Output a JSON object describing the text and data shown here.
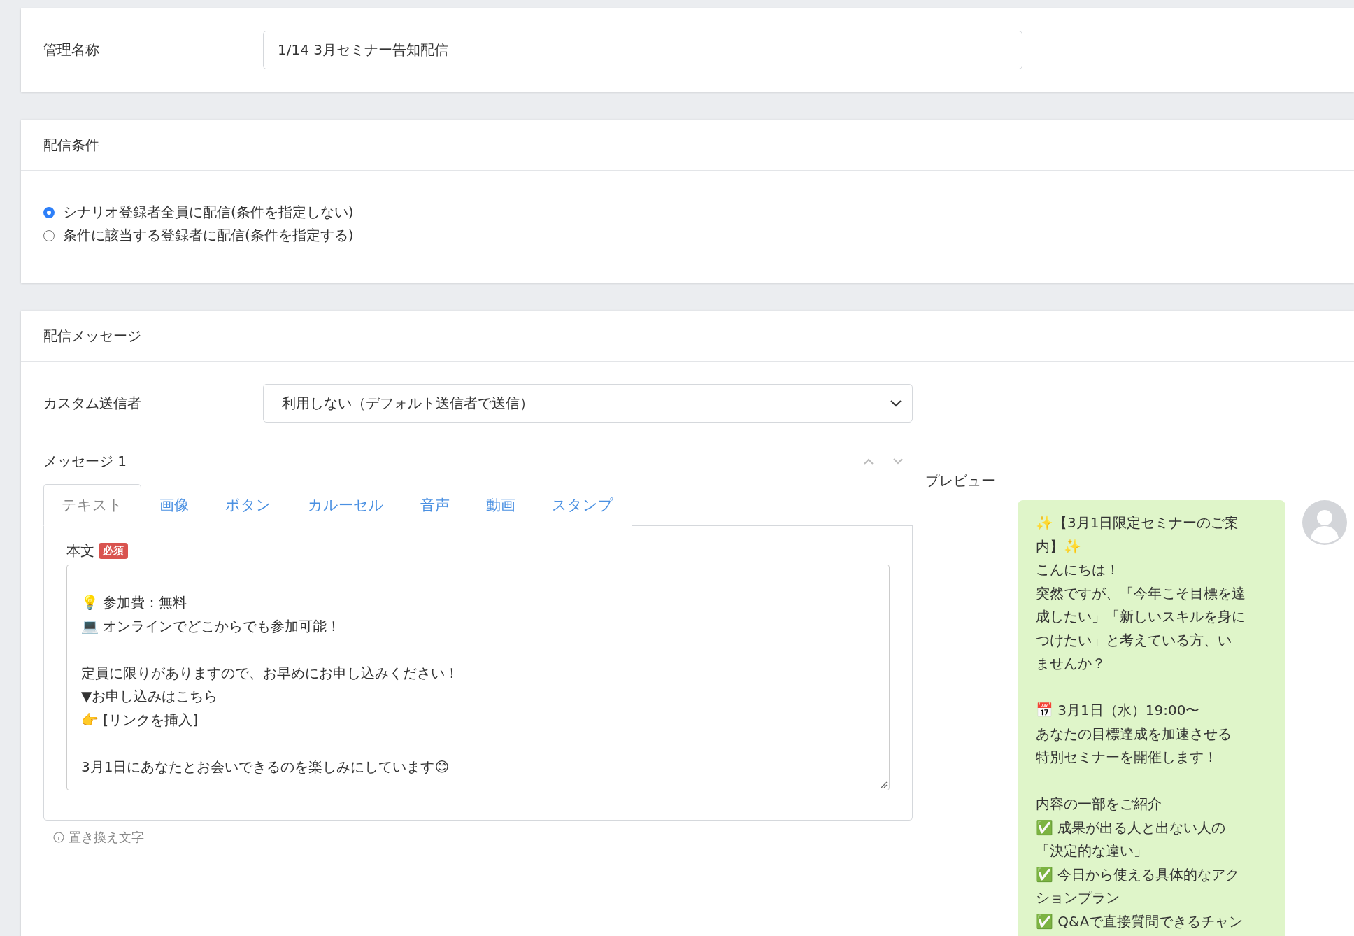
{
  "name_section": {
    "label": "管理名称",
    "value": "1/14 3月セミナー告知配信"
  },
  "conditions": {
    "title": "配信条件",
    "options": [
      {
        "label": "シナリオ登録者全員に配信(条件を指定しない)",
        "selected": true
      },
      {
        "label": "条件に該当する登録者に配信(条件を指定する)",
        "selected": false
      }
    ]
  },
  "message_section": {
    "title": "配信メッセージ",
    "sender_label": "カスタム送信者",
    "sender_value": "利用しない（デフォルト送信者で送信）",
    "message_title": "メッセージ 1",
    "tabs": [
      {
        "label": "テキスト",
        "selected": true
      },
      {
        "label": "画像",
        "selected": false
      },
      {
        "label": "ボタン",
        "selected": false
      },
      {
        "label": "カルーセル",
        "selected": false
      },
      {
        "label": "音声",
        "selected": false
      },
      {
        "label": "動画",
        "selected": false
      },
      {
        "label": "スタンプ",
        "selected": false
      }
    ],
    "body_label": "本文",
    "required_badge": "必須",
    "body_paragraphs": [
      [
        "💡 参加費：無料",
        "💻 オンラインでどこからでも参加可能！"
      ],
      [
        "定員に限りがありますので、お早めにお申し込みください！",
        "▼お申し込みはこちら",
        "👉 [リンクを挿入]"
      ],
      [
        "3月1日にあなたとお会いできるのを楽しみにしています😊"
      ]
    ],
    "replace_link": "置き換え文字",
    "preview_label": "プレビュー",
    "preview_paragraphs": [
      [
        "✨【3月1日限定セミナーのご案",
        "内】✨",
        "こんにちは！",
        "突然ですが、「今年こそ目標を達",
        "成したい」「新しいスキルを身に",
        "つけたい」と考えている方、い",
        "ませんか？"
      ],
      [
        "📅 3月1日（水）19:00〜",
        "あなたの目標達成を加速させる",
        "特別セミナーを開催します！"
      ],
      [
        "内容の一部をご紹介",
        "✅ 成果が出る人と出ない人の",
        "「決定的な違い」",
        "✅ 今日から使える具体的なアク",
        "ションプラン",
        "✅ Q&Aで直接質問できるチャン"
      ]
    ]
  }
}
